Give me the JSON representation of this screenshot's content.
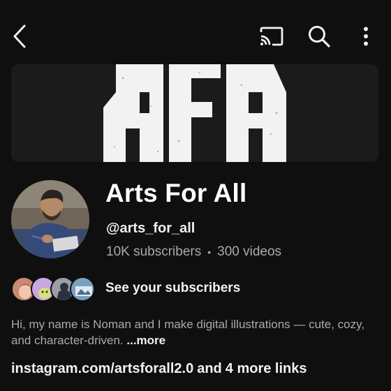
{
  "header": {
    "back_icon": "back-arrow-icon",
    "cast_icon": "cast-icon",
    "search_icon": "search-icon",
    "more_icon": "more-vertical-icon"
  },
  "banner": {
    "logo_text": "AFA",
    "background": "#1b1b1b",
    "logo_color": "#f2f2f2"
  },
  "channel": {
    "name": "Arts For All",
    "handle": "@arts_for_all",
    "subscribers": "10K subscribers",
    "separator": "•",
    "videos": "300 videos"
  },
  "subscribers_row": {
    "label": "See your subscribers"
  },
  "description": {
    "text": "Hi, my name is Noman and I make digital illustrations — cute, cozy, and character-driven.",
    "more_label": "...more"
  },
  "links": {
    "primary": "instagram.com/artsforall2.0",
    "joiner": "and",
    "more": "4 more links"
  },
  "colors": {
    "background": "#0f0f0f",
    "primary_text": "#f1f1f1",
    "secondary_text": "#aaaaaa"
  }
}
